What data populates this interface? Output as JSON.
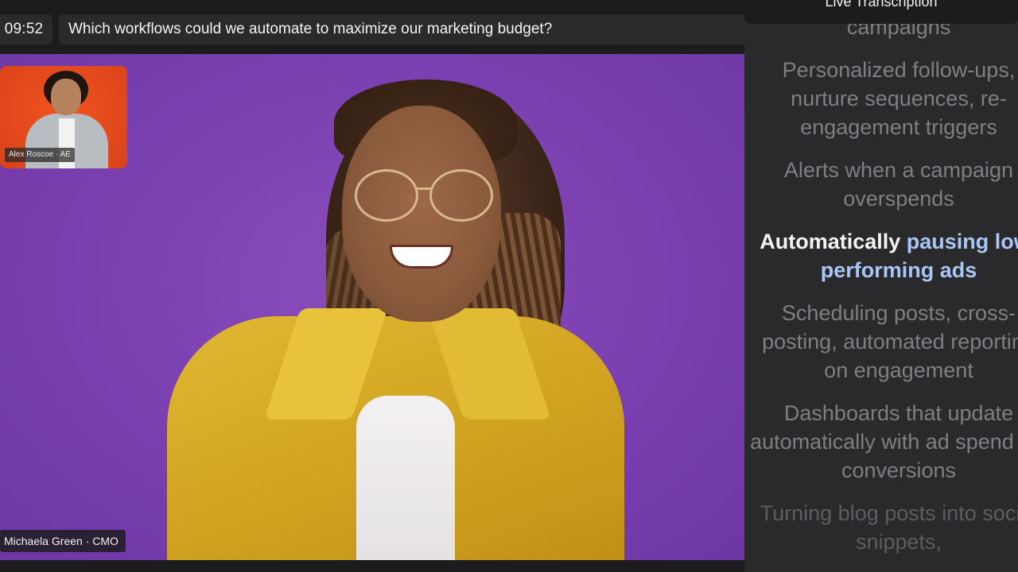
{
  "header": {
    "timer": "09:52",
    "question": "Which workflows could we automate to maximize our marketing budget?"
  },
  "main_video": {
    "participant_label": "Michaela Green · CMO"
  },
  "pip_video": {
    "participant_label": "Alex Roscoe · AE"
  },
  "transcription": {
    "title": "Live Transcription",
    "lines": [
      {
        "text": "campaigns"
      },
      {
        "text": "Personalized follow-ups, nurture sequences, re-engagement triggers"
      },
      {
        "text": "Alerts when a campaign overspends"
      },
      {
        "active_plain": "Automatically ",
        "active_highlight": "pausing low-performing ads"
      },
      {
        "text": "Scheduling posts, cross-posting, automated reporting on engagement"
      },
      {
        "text": "Dashboards that update automatically with ad spend vs. conversions"
      },
      {
        "text": "Turning blog posts into social snippets,"
      }
    ]
  },
  "colors": {
    "video_background": "#7a3fb0",
    "pip_background": "#e64a1c",
    "highlight": "#a9c6f6",
    "panel_background": "#2a2a2c"
  }
}
